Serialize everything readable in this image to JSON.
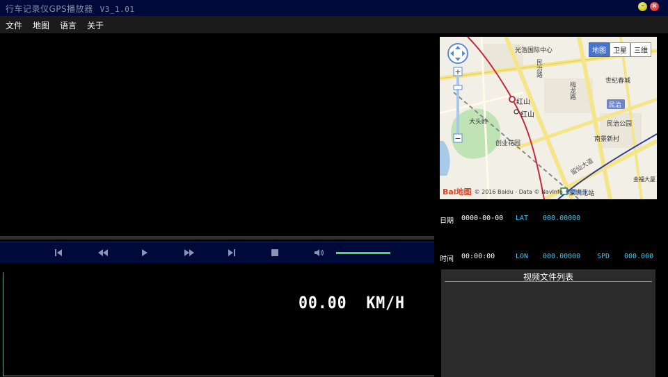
{
  "window": {
    "title": "行车记录仪GPS播放器",
    "version": "V3_1.01"
  },
  "menu": {
    "items": [
      {
        "label": "文件"
      },
      {
        "label": "地图"
      },
      {
        "label": "语言"
      },
      {
        "label": "关于"
      }
    ]
  },
  "player": {
    "volume_level": 1.0
  },
  "speed": {
    "value": "00.00",
    "unit": "KM/H"
  },
  "map": {
    "types": [
      "地图",
      "卫星",
      "三维"
    ],
    "active_type": "地图",
    "labels": {
      "l1": "光浩国际中心",
      "l2": "红山",
      "l3": "红山",
      "l4": "世纪春城",
      "l5": "民治",
      "l6": "民治公园",
      "l7": "大头岭",
      "l8": "创业花园",
      "l9": "南景新村",
      "l10": "深圳北站",
      "l11": "金福大厦",
      "r1": "民治路",
      "r2": "梅龙路",
      "r3": "留仙大道"
    },
    "footer": {
      "logo": "Bai地图",
      "copyright": "© 2016 Baidu - Data © NavInfo",
      "link": "使用条款"
    }
  },
  "gps": {
    "date_label": "日期",
    "date_value": "0000-00-00",
    "lat_key": "LAT",
    "lat_value": "000.00000",
    "time_label": "时间",
    "time_value": "00:00:00",
    "lon_key": "LON",
    "lon_value": "000.00000",
    "spd_key": "SPD",
    "spd_value": "000.000"
  },
  "file_list": {
    "title": "视频文件列表"
  },
  "colors": {
    "titlebar": "#000a3a",
    "accent_cyan": "#42c8f2",
    "volume_green": "#3ee067"
  }
}
